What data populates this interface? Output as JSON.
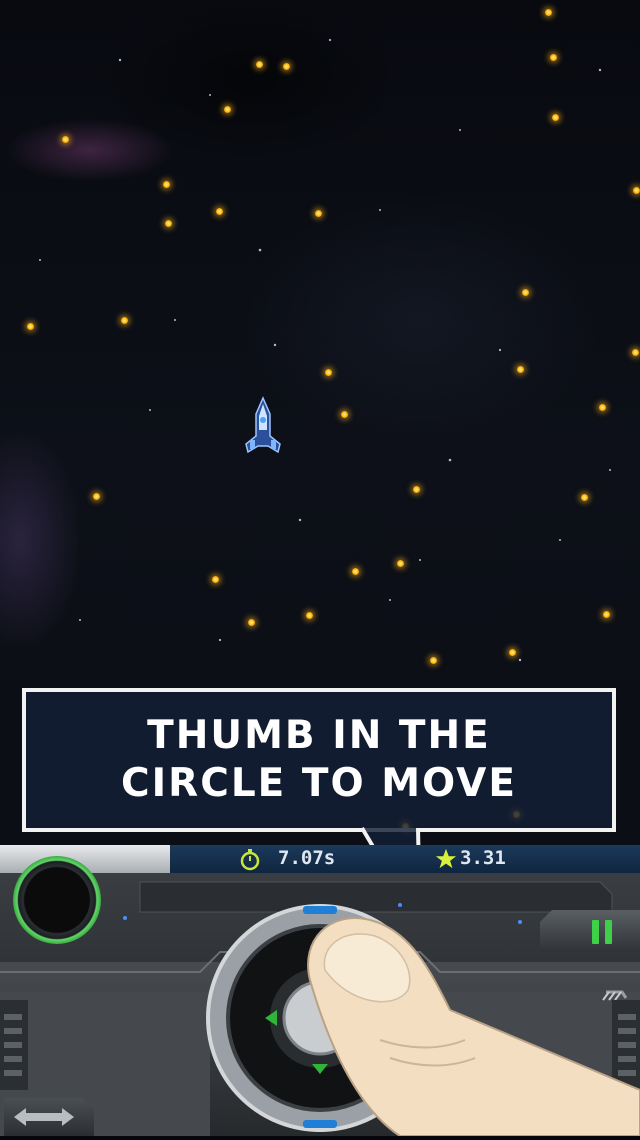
{
  "tutorial": {
    "line1": "THUMB IN THE",
    "line2": "CIRCLE TO MOVE"
  },
  "hud": {
    "timer_icon": "stopwatch-icon",
    "timer": "7.07s",
    "star_icon": "star-icon",
    "stars": "3.31"
  },
  "controls": {
    "record_button_icon": "record-circle-icon",
    "pause_button_icon": "pause-icon",
    "resize_button_icon": "left-right-arrows-icon",
    "joystick_icon": "virtual-joystick-icon"
  },
  "colors": {
    "orb": "#ffc21a",
    "accent_green": "#3fd04a",
    "hud_text": "#dfe7f0",
    "callout_border": "#f2f2f2",
    "callout_bg": "#142037"
  }
}
